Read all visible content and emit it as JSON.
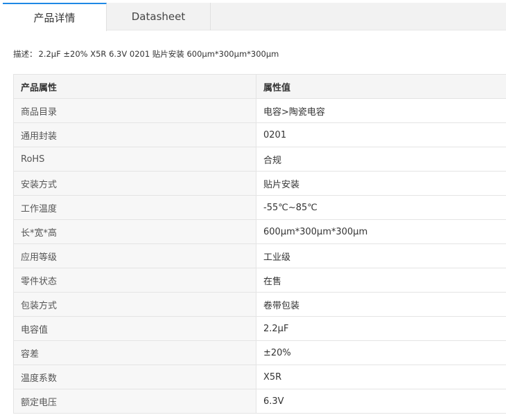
{
  "tabs": [
    {
      "label": "产品详情",
      "active": true
    },
    {
      "label": "Datasheet",
      "active": false
    }
  ],
  "description": {
    "label": "描述：",
    "text": "2.2μF ±20% X5R 6.3V 0201 贴片安装 600μm*300μm*300μm"
  },
  "table": {
    "headers": [
      "产品属性",
      "属性值"
    ],
    "rows": [
      {
        "name": "商品目录",
        "value": "电容>陶瓷电容"
      },
      {
        "name": "通用封装",
        "value": "0201"
      },
      {
        "name": "RoHS",
        "value": "合规"
      },
      {
        "name": "安装方式",
        "value": "贴片安装"
      },
      {
        "name": "工作温度",
        "value": "-55℃~85℃"
      },
      {
        "name": "长*宽*高",
        "value": "600μm*300μm*300μm"
      },
      {
        "name": "应用等级",
        "value": "工业级"
      },
      {
        "name": "零件状态",
        "value": "在售"
      },
      {
        "name": "包装方式",
        "value": "卷带包装"
      },
      {
        "name": "电容值",
        "value": "2.2μF"
      },
      {
        "name": "容差",
        "value": "±20%"
      },
      {
        "name": "温度系数",
        "value": "X5R"
      },
      {
        "name": "额定电压",
        "value": "6.3V"
      }
    ]
  },
  "colors": {
    "accent": "#1e88e5",
    "header_bg": "#f5f5f5",
    "border": "#e4e4e4"
  }
}
